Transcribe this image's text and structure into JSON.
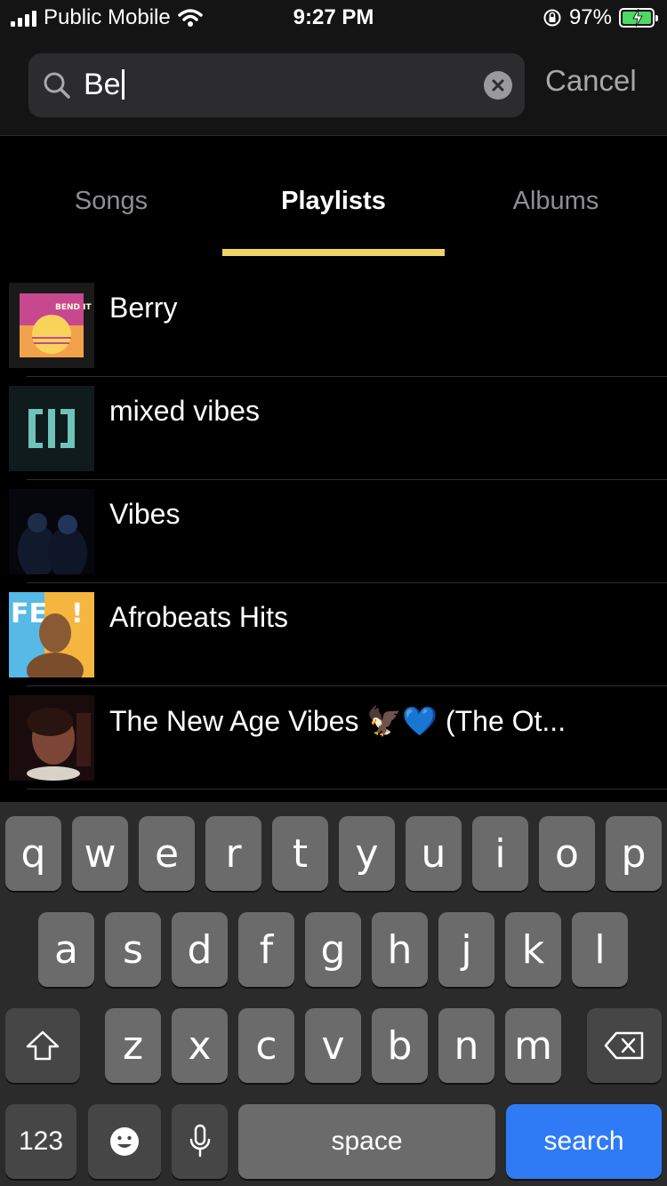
{
  "status_bar": {
    "carrier": "Public Mobile",
    "time": "9:27 PM",
    "battery_percent": "97%"
  },
  "search": {
    "query": "Be",
    "cancel_label": "Cancel"
  },
  "tabs": [
    {
      "label": "Songs"
    },
    {
      "label": "Playlists",
      "active": true
    },
    {
      "label": "Albums"
    }
  ],
  "results": [
    {
      "title": "Berry"
    },
    {
      "title": "mixed vibes"
    },
    {
      "title": "Vibes"
    },
    {
      "title": "Afrobeats Hits"
    },
    {
      "title": "The New Age Vibes 🦅💙 (The Ot..."
    }
  ],
  "keyboard": {
    "row1": [
      "q",
      "w",
      "e",
      "r",
      "t",
      "y",
      "u",
      "i",
      "o",
      "p"
    ],
    "row2": [
      "a",
      "s",
      "d",
      "f",
      "g",
      "h",
      "j",
      "k",
      "l"
    ],
    "row3": [
      "z",
      "x",
      "c",
      "v",
      "b",
      "n",
      "m"
    ],
    "numbers_label": "123",
    "space_label": "space",
    "search_label": "search"
  },
  "colors": {
    "tab_indicator": "#efd36b",
    "search_key": "#2f7bf6",
    "battery": "#4cd964"
  }
}
